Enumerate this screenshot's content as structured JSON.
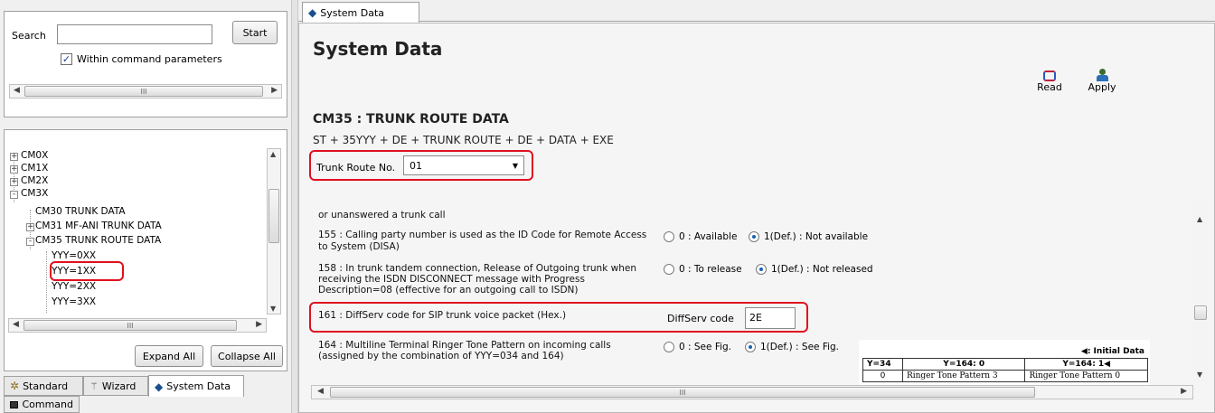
{
  "search": {
    "label": "Search",
    "value": "",
    "start_label": "Start",
    "within_label": "Within command parameters",
    "within_checked": true
  },
  "tree": {
    "items": [
      {
        "label": "CM0X",
        "expander": "+"
      },
      {
        "label": "CM1X",
        "expander": "+"
      },
      {
        "label": "CM2X",
        "expander": "+"
      },
      {
        "label": "CM3X",
        "expander": "-"
      },
      {
        "label": "CM30 TRUNK DATA"
      },
      {
        "label": "CM31 MF-ANI TRUNK DATA",
        "expander": "+"
      },
      {
        "label": "CM35 TRUNK ROUTE DATA",
        "expander": "-"
      },
      {
        "label": "YYY=0XX"
      },
      {
        "label": "YYY=1XX"
      },
      {
        "label": "YYY=2XX"
      },
      {
        "label": "YYY=3XX"
      }
    ],
    "expand_all": "Expand All",
    "collapse_all": "Collapse All"
  },
  "bottom_tabs": {
    "standard": "Standard",
    "wizard": "Wizard",
    "system_data": "System Data",
    "command": "Command"
  },
  "right": {
    "tab_label": "System Data",
    "page_title": "System Data",
    "read_label": "Read",
    "apply_label": "Apply",
    "cm_title": "CM35 : TRUNK ROUTE DATA",
    "formula": "ST + 35YYY + DE + TRUNK ROUTE + DE + DATA + EXE",
    "trunk_route_label": "Trunk Route No.",
    "trunk_route_value": "01",
    "cut_text": "or unanswered a trunk call",
    "rows": {
      "r155": {
        "text1": "155 : Calling party number is used as the ID Code for Remote Access",
        "text2": "to System (DISA)",
        "opt0": "0 : Available",
        "opt1": "1(Def.) : Not available"
      },
      "r158": {
        "text1": "158 : In trunk tandem connection, Release of Outgoing trunk when",
        "text2": "receiving the ISDN DISCONNECT message with Progress",
        "text3": "Description=08 (effective for an outgoing call to ISDN)",
        "opt0": "0 : To release",
        "opt1": "1(Def.) : Not released"
      },
      "r161": {
        "text1": "161 : DiffServ code for SIP trunk voice packet (Hex.)",
        "field_label": "DiffServ code",
        "field_value": "2E"
      },
      "r164": {
        "text1": "164 : Multiline Terminal Ringer Tone Pattern on incoming calls",
        "text2": "(assigned by the combination of YYY=034 and 164)",
        "opt0": "0 : See Fig.",
        "opt1": "1(Def.) : See Fig."
      }
    },
    "figure": {
      "legend": "◀: Initial Data",
      "headers": [
        "Y=34",
        "Y=164: 0",
        "Y=164: 1◀"
      ],
      "row": [
        "0",
        "Ringer Tone Pattern 3",
        "Ringer Tone Pattern 0"
      ]
    }
  },
  "scroll_glyph": "III"
}
